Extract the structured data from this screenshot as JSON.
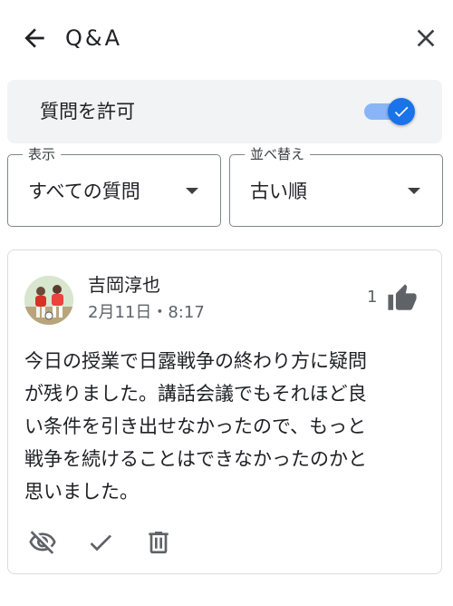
{
  "header": {
    "title": "Q&A",
    "back_icon": "arrow-back-icon",
    "close_icon": "close-icon"
  },
  "settings": {
    "allow_label": "質問を許可",
    "allow_enabled": true,
    "accent_color": "#1a73e8"
  },
  "filters": {
    "show": {
      "legend": "表示",
      "value": "すべての質問"
    },
    "sort": {
      "legend": "並べ替え",
      "value": "古い順"
    }
  },
  "question": {
    "author": "吉岡淳也",
    "meta": "2月11日・8:17",
    "likes": "1",
    "text": "今日の授業で日露戦争の終わり方に疑問\nが残りました。講話会議でもそれほど良\nい条件を引き出せなかったので、もっと\n戦争を続けることはできなかったのかと\n思いました。",
    "actions": [
      "visibility-off-icon",
      "check-icon",
      "delete-icon"
    ]
  }
}
